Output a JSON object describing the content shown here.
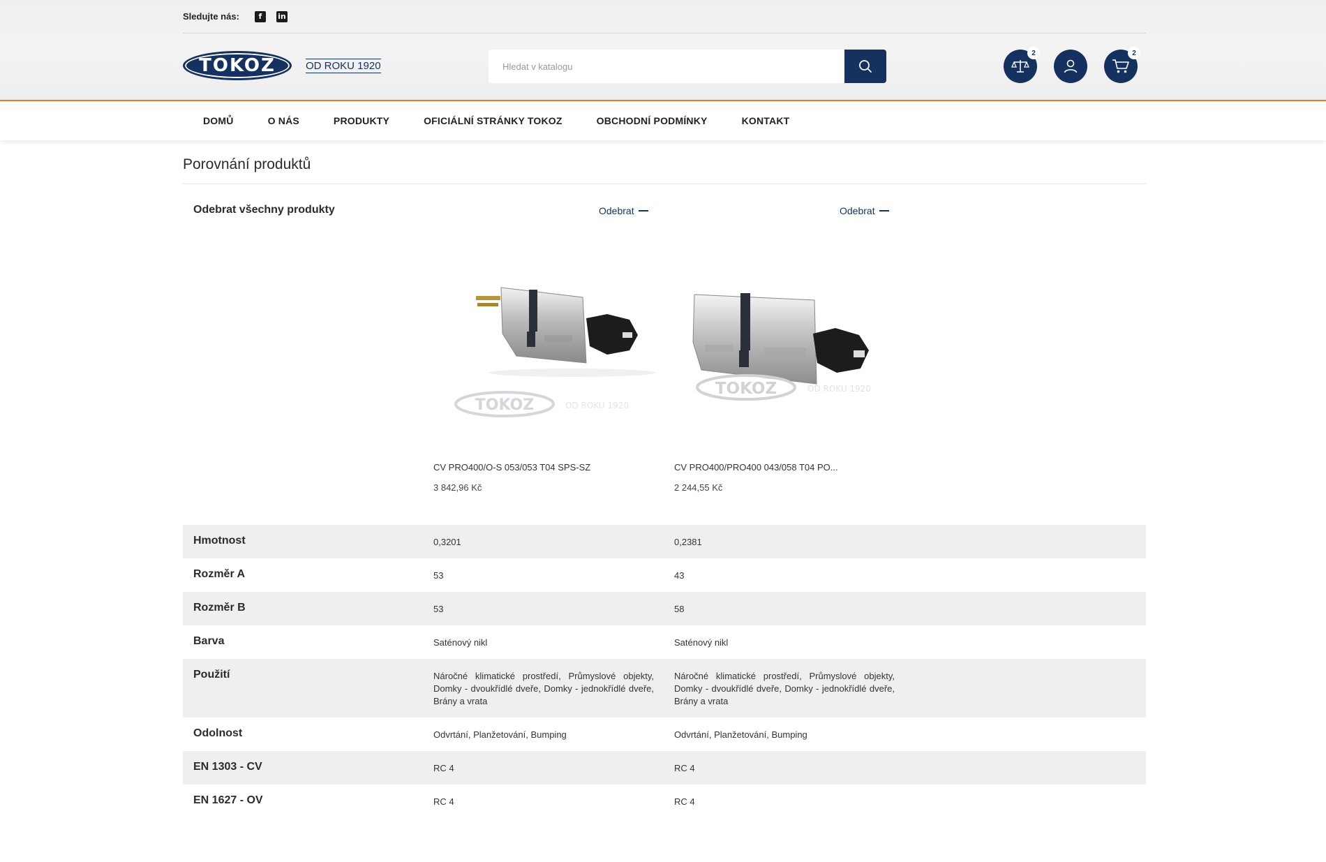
{
  "topbar": {
    "follow_label": "Sledujte nás:",
    "social": [
      "facebook-icon",
      "linkedin-icon"
    ]
  },
  "header": {
    "logo_text": "TOKOZ",
    "since_text": "OD ROKU 1920",
    "search_placeholder": "Hledat v katalogu",
    "compare_count": "2",
    "cart_count": "2"
  },
  "nav": [
    "DOMŮ",
    "O NÁS",
    "PRODUKTY",
    "OFICIÁLNÍ STRÁNKY TOKOZ",
    "OBCHODNÍ PODMÍNKY",
    "KONTAKT"
  ],
  "page": {
    "title": "Porovnání produktů",
    "remove_all": "Odebrat všechny produkty",
    "remove_label": "Odebrat"
  },
  "products": [
    {
      "name": "CV PRO400/O-S 053/053 T04 SPS-SZ",
      "price": "3 842,96 Kč",
      "image_watermark": "TOKOZ",
      "image_watermark_sub": "OD ROKU 1920"
    },
    {
      "name": "CV PRO400/PRO400 043/058 T04 PO...",
      "price": "2 244,55 Kč",
      "image_watermark": "TOKOZ",
      "image_watermark_sub": "OD ROKU 1920"
    }
  ],
  "compare_rows": [
    {
      "label": "Hmotnost",
      "values": [
        "0,3201",
        "0,2381"
      ]
    },
    {
      "label": "Rozměr A",
      "values": [
        "53",
        "43"
      ]
    },
    {
      "label": "Rozměr B",
      "values": [
        "53",
        "58"
      ]
    },
    {
      "label": "Barva",
      "values": [
        "Saténový nikl",
        "Saténový nikl"
      ]
    },
    {
      "label": "Použití",
      "values": [
        "Náročné klimatické prostředí, Průmyslové objekty, Domky - dvoukřídlé dveře, Domky - jednokřídlé dveře, Brány a vrata",
        "Náročné klimatické prostředí, Průmyslové objekty, Domky - dvoukřídlé dveře, Domky - jednokřídlé dveře, Brány a vrata"
      ]
    },
    {
      "label": "Odolnost",
      "values": [
        "Odvrtání, Planžetování, Bumping",
        "Odvrtání, Planžetování, Bumping"
      ]
    },
    {
      "label": "EN 1303 - CV",
      "values": [
        "RC 4",
        "RC 4"
      ]
    },
    {
      "label": "EN 1627 - OV",
      "values": [
        "RC 4",
        "RC 4"
      ]
    }
  ],
  "colors": {
    "brand_navy": "#14315f",
    "accent_orange": "#e97c2a",
    "row_alt": "#efefef"
  }
}
